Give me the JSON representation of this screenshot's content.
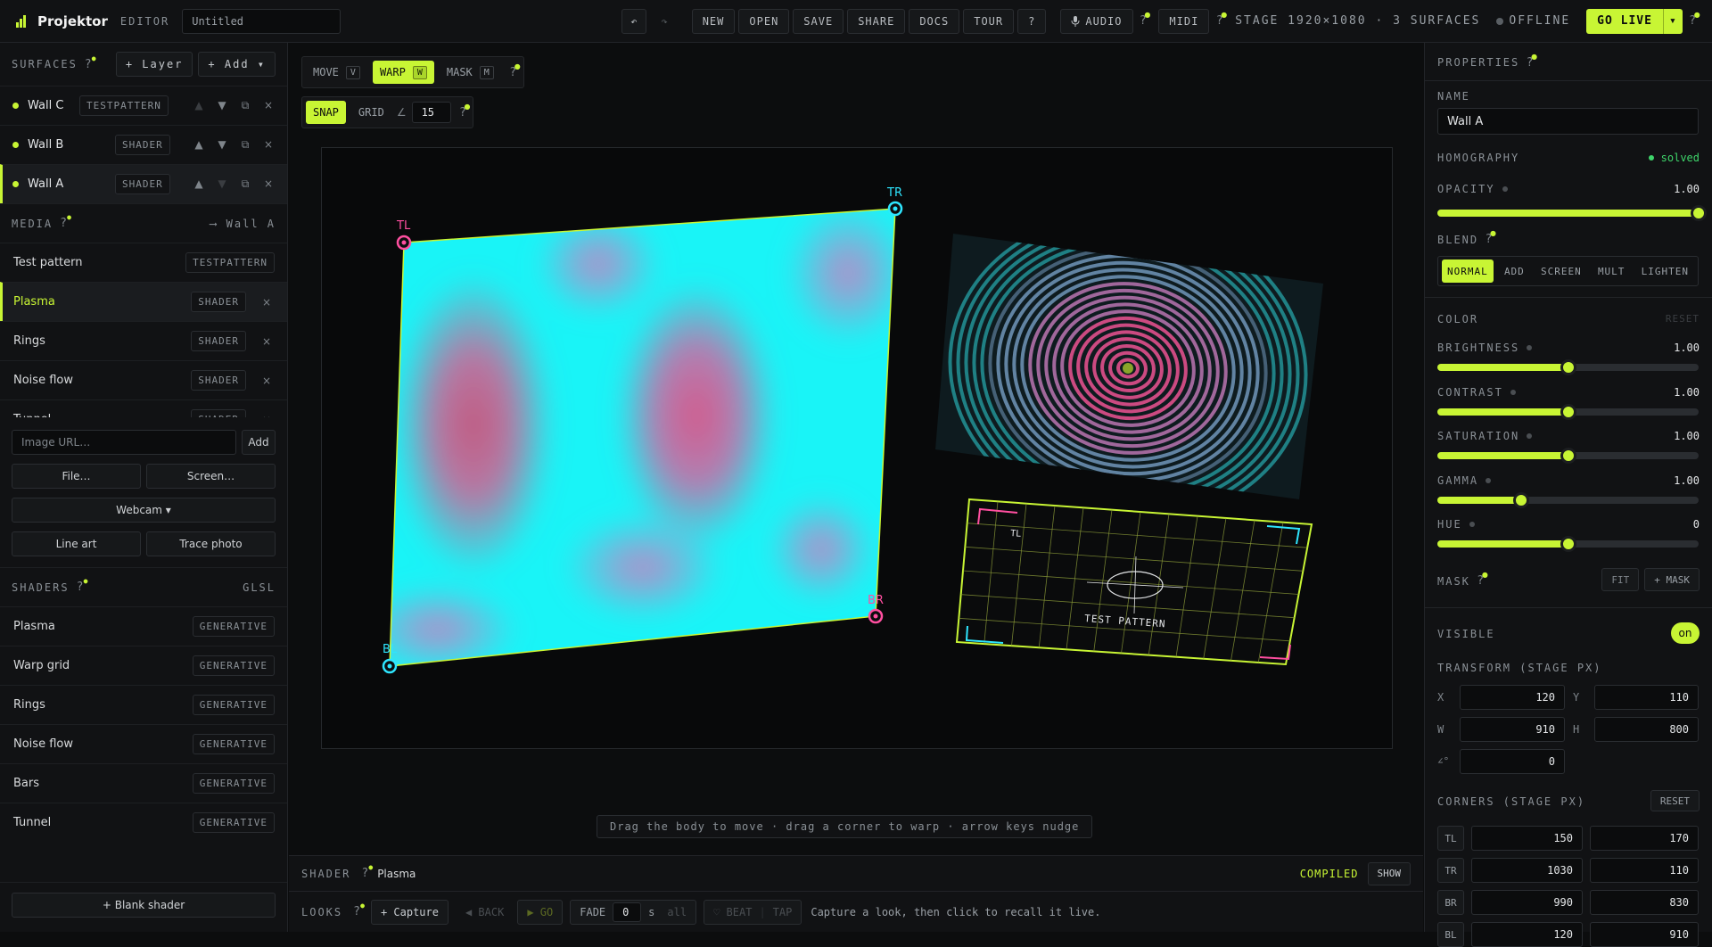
{
  "app": {
    "name": "Projektor",
    "mode_label": "EDITOR",
    "title_value": "Untitled"
  },
  "toolbar": {
    "undo": "↶",
    "redo": "↷",
    "new": "NEW",
    "open": "OPEN",
    "save": "SAVE",
    "share": "SHARE",
    "docs": "DOCS",
    "tour": "TOUR",
    "help": "?",
    "audio": "AUDIO",
    "midi": "MIDI",
    "stage": "STAGE 1920×1080 · 3 SURFACES",
    "status": "OFFLINE",
    "go_live": "GO LIVE",
    "go_live_caret": "▾"
  },
  "surfaces": {
    "heading": "SURFACES",
    "layer_btn": "+ Layer",
    "add_btn": "+ Add ▾",
    "items": [
      {
        "name": "Wall C",
        "type": "TESTPATTERN"
      },
      {
        "name": "Wall B",
        "type": "SHADER"
      },
      {
        "name": "Wall A",
        "type": "SHADER"
      }
    ]
  },
  "media": {
    "heading": "MEDIA",
    "target": "⟶ Wall A",
    "items": [
      {
        "name": "Test pattern",
        "type": "TESTPATTERN"
      },
      {
        "name": "Plasma",
        "type": "SHADER"
      },
      {
        "name": "Rings",
        "type": "SHADER"
      },
      {
        "name": "Noise flow",
        "type": "SHADER"
      },
      {
        "name": "Tunnel",
        "type": "SHADER"
      }
    ],
    "url_placeholder": "Image URL…",
    "add": "Add",
    "file": "File…",
    "screen": "Screen…",
    "webcam": "Webcam ▾",
    "line_art": "Line art",
    "trace_photo": "Trace photo"
  },
  "shaders": {
    "heading": "SHADERS",
    "lang": "GLSL",
    "items": [
      {
        "name": "Plasma",
        "type": "GENERATIVE"
      },
      {
        "name": "Warp grid",
        "type": "GENERATIVE"
      },
      {
        "name": "Rings",
        "type": "GENERATIVE"
      },
      {
        "name": "Noise flow",
        "type": "GENERATIVE"
      },
      {
        "name": "Bars",
        "type": "GENERATIVE"
      },
      {
        "name": "Tunnel",
        "type": "GENERATIVE"
      }
    ],
    "blank": "+ Blank shader"
  },
  "tools": {
    "move": "MOVE",
    "move_key": "V",
    "warp": "WARP",
    "warp_key": "W",
    "mask": "MASK",
    "mask_key": "M",
    "snap": "SNAP",
    "grid": "GRID",
    "angle_icon": "∠",
    "angle_value": "15"
  },
  "canvas": {
    "corner_tl": "TL",
    "corner_tr": "TR",
    "corner_br": "BR",
    "corner_bl": "BL",
    "pattern_tl": "TL",
    "pattern_label": "TEST PATTERN",
    "hint": "Drag the body to move · drag a corner to warp · arrow keys nudge"
  },
  "shader_bar": {
    "label": "SHADER",
    "name": "Plasma",
    "status": "COMPILED",
    "show": "SHOW"
  },
  "looks_bar": {
    "label": "LOOKS",
    "capture": "+ Capture",
    "back": "◀ BACK",
    "go": "▶ GO",
    "fade": "FADE",
    "fade_value": "0",
    "fade_unit": "s",
    "all": "all",
    "beat": "♡ BEAT",
    "tap": "TAP",
    "hint": "Capture a look, then click to recall it live."
  },
  "properties": {
    "heading": "PROPERTIES",
    "name_label": "NAME",
    "name_value": "Wall A",
    "homography_label": "HOMOGRAPHY",
    "homography_status": "solved",
    "opacity_label": "OPACITY",
    "opacity_value": "1.00",
    "opacity": 1.0,
    "blend_label": "BLEND",
    "blend_modes": [
      "NORMAL",
      "ADD",
      "SCREEN",
      "MULT",
      "LIGHTEN"
    ],
    "blend_selected": "NORMAL",
    "color_label": "COLOR",
    "color_reset": "RESET",
    "brightness_label": "BRIGHTNESS",
    "brightness_value": "1.00",
    "brightness": 0.5,
    "contrast_label": "CONTRAST",
    "contrast_value": "1.00",
    "contrast": 0.5,
    "saturation_label": "SATURATION",
    "saturation_value": "1.00",
    "saturation": 0.5,
    "gamma_label": "GAMMA",
    "gamma_value": "1.00",
    "gamma": 0.32,
    "hue_label": "HUE",
    "hue_value": "0",
    "hue": 0.5,
    "mask_label": "MASK",
    "mask_fit": "FIT",
    "mask_add": "+ MASK",
    "visible_label": "VISIBLE",
    "visible_value": "on",
    "transform_label": "TRANSFORM (STAGE PX)",
    "x_label": "X",
    "x": "120",
    "y_label": "Y",
    "y": "110",
    "w_label": "W",
    "w": "910",
    "h_label": "H",
    "h": "800",
    "angle_label": "∠°",
    "angle": "0",
    "corners_label": "CORNERS (STAGE PX)",
    "corners_reset": "RESET",
    "corners": [
      {
        "label": "TL",
        "x": "150",
        "y": "170"
      },
      {
        "label": "TR",
        "x": "1030",
        "y": "110"
      },
      {
        "label": "BR",
        "x": "990",
        "y": "830"
      },
      {
        "label": "BL",
        "x": "120",
        "y": "910"
      }
    ]
  },
  "colors": {
    "accent": "#c8f534",
    "cyan": "#2ee6ff",
    "pink": "#ff4fa0",
    "bg": "#0c0d0e"
  }
}
